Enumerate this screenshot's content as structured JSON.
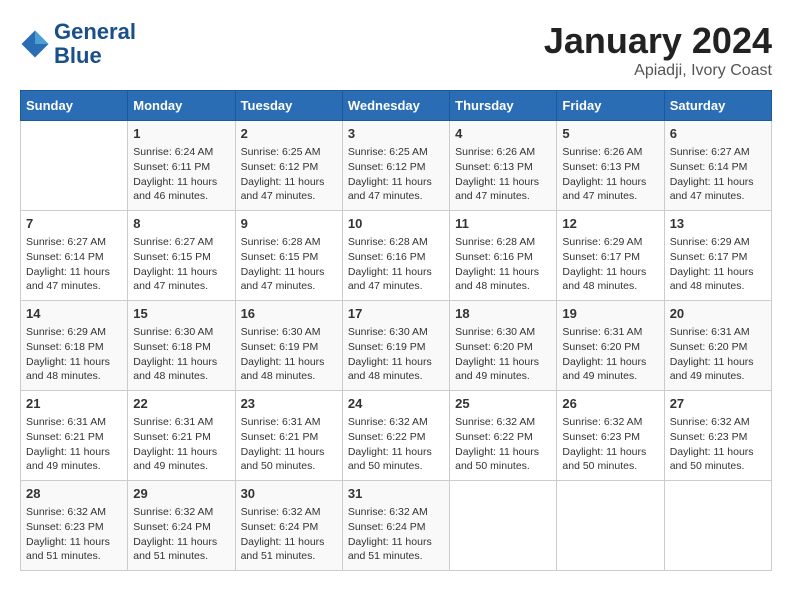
{
  "logo": {
    "line1": "General",
    "line2": "Blue"
  },
  "title": "January 2024",
  "location": "Apiadji, Ivory Coast",
  "days_of_week": [
    "Sunday",
    "Monday",
    "Tuesday",
    "Wednesday",
    "Thursday",
    "Friday",
    "Saturday"
  ],
  "weeks": [
    [
      {
        "day": "",
        "info": ""
      },
      {
        "day": "1",
        "info": "Sunrise: 6:24 AM\nSunset: 6:11 PM\nDaylight: 11 hours and 46 minutes."
      },
      {
        "day": "2",
        "info": "Sunrise: 6:25 AM\nSunset: 6:12 PM\nDaylight: 11 hours and 47 minutes."
      },
      {
        "day": "3",
        "info": "Sunrise: 6:25 AM\nSunset: 6:12 PM\nDaylight: 11 hours and 47 minutes."
      },
      {
        "day": "4",
        "info": "Sunrise: 6:26 AM\nSunset: 6:13 PM\nDaylight: 11 hours and 47 minutes."
      },
      {
        "day": "5",
        "info": "Sunrise: 6:26 AM\nSunset: 6:13 PM\nDaylight: 11 hours and 47 minutes."
      },
      {
        "day": "6",
        "info": "Sunrise: 6:27 AM\nSunset: 6:14 PM\nDaylight: 11 hours and 47 minutes."
      }
    ],
    [
      {
        "day": "7",
        "info": "Sunrise: 6:27 AM\nSunset: 6:14 PM\nDaylight: 11 hours and 47 minutes."
      },
      {
        "day": "8",
        "info": "Sunrise: 6:27 AM\nSunset: 6:15 PM\nDaylight: 11 hours and 47 minutes."
      },
      {
        "day": "9",
        "info": "Sunrise: 6:28 AM\nSunset: 6:15 PM\nDaylight: 11 hours and 47 minutes."
      },
      {
        "day": "10",
        "info": "Sunrise: 6:28 AM\nSunset: 6:16 PM\nDaylight: 11 hours and 47 minutes."
      },
      {
        "day": "11",
        "info": "Sunrise: 6:28 AM\nSunset: 6:16 PM\nDaylight: 11 hours and 48 minutes."
      },
      {
        "day": "12",
        "info": "Sunrise: 6:29 AM\nSunset: 6:17 PM\nDaylight: 11 hours and 48 minutes."
      },
      {
        "day": "13",
        "info": "Sunrise: 6:29 AM\nSunset: 6:17 PM\nDaylight: 11 hours and 48 minutes."
      }
    ],
    [
      {
        "day": "14",
        "info": "Sunrise: 6:29 AM\nSunset: 6:18 PM\nDaylight: 11 hours and 48 minutes."
      },
      {
        "day": "15",
        "info": "Sunrise: 6:30 AM\nSunset: 6:18 PM\nDaylight: 11 hours and 48 minutes."
      },
      {
        "day": "16",
        "info": "Sunrise: 6:30 AM\nSunset: 6:19 PM\nDaylight: 11 hours and 48 minutes."
      },
      {
        "day": "17",
        "info": "Sunrise: 6:30 AM\nSunset: 6:19 PM\nDaylight: 11 hours and 48 minutes."
      },
      {
        "day": "18",
        "info": "Sunrise: 6:30 AM\nSunset: 6:20 PM\nDaylight: 11 hours and 49 minutes."
      },
      {
        "day": "19",
        "info": "Sunrise: 6:31 AM\nSunset: 6:20 PM\nDaylight: 11 hours and 49 minutes."
      },
      {
        "day": "20",
        "info": "Sunrise: 6:31 AM\nSunset: 6:20 PM\nDaylight: 11 hours and 49 minutes."
      }
    ],
    [
      {
        "day": "21",
        "info": "Sunrise: 6:31 AM\nSunset: 6:21 PM\nDaylight: 11 hours and 49 minutes."
      },
      {
        "day": "22",
        "info": "Sunrise: 6:31 AM\nSunset: 6:21 PM\nDaylight: 11 hours and 49 minutes."
      },
      {
        "day": "23",
        "info": "Sunrise: 6:31 AM\nSunset: 6:21 PM\nDaylight: 11 hours and 50 minutes."
      },
      {
        "day": "24",
        "info": "Sunrise: 6:32 AM\nSunset: 6:22 PM\nDaylight: 11 hours and 50 minutes."
      },
      {
        "day": "25",
        "info": "Sunrise: 6:32 AM\nSunset: 6:22 PM\nDaylight: 11 hours and 50 minutes."
      },
      {
        "day": "26",
        "info": "Sunrise: 6:32 AM\nSunset: 6:23 PM\nDaylight: 11 hours and 50 minutes."
      },
      {
        "day": "27",
        "info": "Sunrise: 6:32 AM\nSunset: 6:23 PM\nDaylight: 11 hours and 50 minutes."
      }
    ],
    [
      {
        "day": "28",
        "info": "Sunrise: 6:32 AM\nSunset: 6:23 PM\nDaylight: 11 hours and 51 minutes."
      },
      {
        "day": "29",
        "info": "Sunrise: 6:32 AM\nSunset: 6:24 PM\nDaylight: 11 hours and 51 minutes."
      },
      {
        "day": "30",
        "info": "Sunrise: 6:32 AM\nSunset: 6:24 PM\nDaylight: 11 hours and 51 minutes."
      },
      {
        "day": "31",
        "info": "Sunrise: 6:32 AM\nSunset: 6:24 PM\nDaylight: 11 hours and 51 minutes."
      },
      {
        "day": "",
        "info": ""
      },
      {
        "day": "",
        "info": ""
      },
      {
        "day": "",
        "info": ""
      }
    ]
  ]
}
